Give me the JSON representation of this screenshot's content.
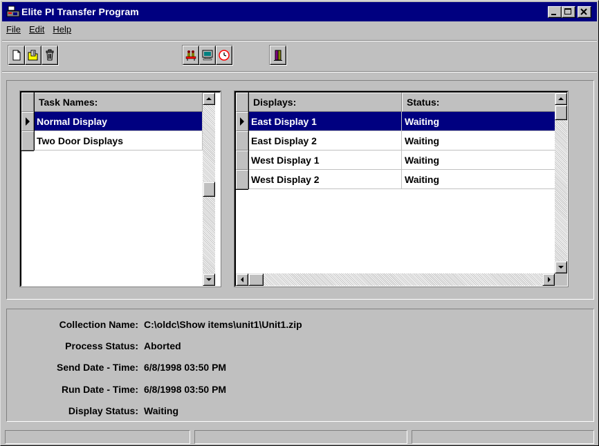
{
  "window": {
    "title": "Elite PI Transfer Program"
  },
  "menu": {
    "items": [
      {
        "label": "File"
      },
      {
        "label": "Edit"
      },
      {
        "label": "Help"
      }
    ]
  },
  "toolbar": {
    "buttons": [
      {
        "icon": "new-document-icon"
      },
      {
        "icon": "open-folder-icon"
      },
      {
        "icon": "trash-icon"
      },
      {
        "icon": "transfer-people-icon"
      },
      {
        "icon": "monitor-icon"
      },
      {
        "icon": "clock-icon"
      },
      {
        "icon": "exit-door-icon"
      }
    ]
  },
  "tasks": {
    "header": "Task Names:",
    "rows": [
      {
        "name": "Normal  Display",
        "selected": true
      },
      {
        "name": "Two Door Displays",
        "selected": false
      }
    ]
  },
  "displays": {
    "headers": [
      "Displays:",
      "Status:"
    ],
    "rows": [
      {
        "display": "East Display 1",
        "status": "Waiting",
        "selected": true
      },
      {
        "display": "East Display 2",
        "status": "Waiting",
        "selected": false
      },
      {
        "display": "West Display 1",
        "status": "Waiting",
        "selected": false
      },
      {
        "display": "West Display 2",
        "status": "Waiting",
        "selected": false
      }
    ]
  },
  "info": {
    "collection_name_label": "Collection Name:",
    "collection_name": "C:\\oldc\\Show items\\unit1\\Unit1.zip",
    "process_status_label": "Process Status:",
    "process_status": "Aborted",
    "send_label": "Send Date - Time:",
    "send_value": "6/8/1998 03:50 PM",
    "run_label": "Run Date - Time:",
    "run_value": "6/8/1998 03:50 PM",
    "display_status_label": "Display Status:",
    "display_status": "Waiting"
  },
  "colors": {
    "title_bar": "#000080",
    "selection": "#000080",
    "face": "#c0c0c0"
  }
}
